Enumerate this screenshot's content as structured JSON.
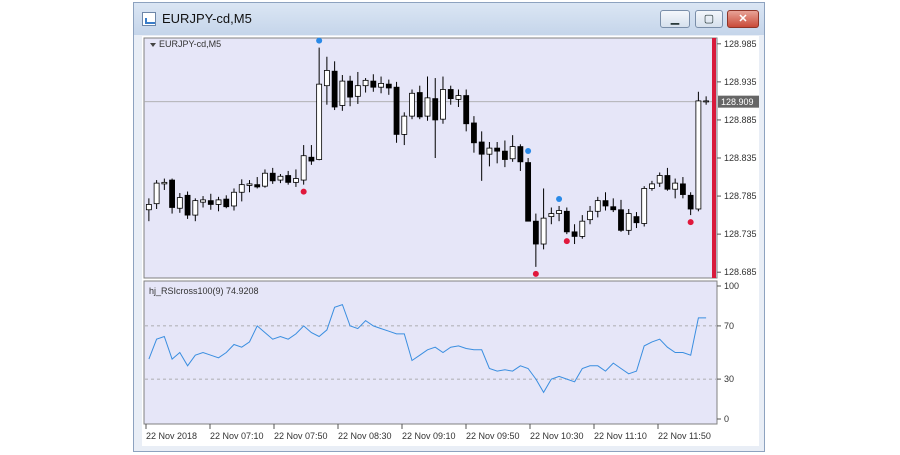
{
  "window": {
    "title": "EURJPY-cd,M5",
    "buttons": {
      "minimize": "minimize",
      "maximize": "maximize",
      "close": "close"
    }
  },
  "chart_data": [
    {
      "type": "candlestick",
      "title": "EURJPY-cd,M5",
      "current_price": "128.909",
      "ylim": [
        128.68,
        128.99
      ],
      "y_ticks": [
        "128.985",
        "128.935",
        "128.885",
        "128.835",
        "128.785",
        "128.735",
        "128.685"
      ],
      "x_ticks": [
        "22 Nov 2018",
        "22 Nov 07:10",
        "22 Nov 07:50",
        "22 Nov 08:30",
        "22 Nov 09:10",
        "22 Nov 09:50",
        "22 Nov 10:30",
        "22 Nov 11:10",
        "22 Nov 11:50"
      ],
      "candles": [
        [
          128.767,
          128.782,
          128.752,
          128.774
        ],
        [
          128.775,
          128.806,
          128.768,
          128.802
        ],
        [
          128.801,
          128.808,
          128.793,
          128.803
        ],
        [
          128.806,
          128.808,
          128.762,
          128.77
        ],
        [
          128.769,
          128.789,
          128.763,
          128.783
        ],
        [
          128.786,
          128.791,
          128.755,
          128.76
        ],
        [
          128.76,
          128.782,
          128.752,
          128.779
        ],
        [
          128.777,
          128.785,
          128.77,
          128.78
        ],
        [
          128.779,
          128.788,
          128.767,
          128.774
        ],
        [
          128.774,
          128.784,
          128.765,
          128.78
        ],
        [
          128.781,
          128.786,
          128.769,
          128.771
        ],
        [
          128.772,
          128.795,
          128.766,
          128.79
        ],
        [
          128.79,
          128.807,
          128.778,
          128.8
        ],
        [
          128.799,
          128.806,
          128.79,
          128.801
        ],
        [
          128.8,
          128.81,
          128.795,
          128.797
        ],
        [
          128.798,
          128.82,
          128.796,
          128.815
        ],
        [
          128.815,
          128.822,
          128.801,
          128.805
        ],
        [
          128.806,
          128.814,
          128.802,
          128.811
        ],
        [
          128.812,
          128.818,
          128.8,
          128.803
        ],
        [
          128.803,
          128.82,
          128.797,
          128.808
        ],
        [
          128.806,
          128.852,
          128.8,
          128.838
        ],
        [
          128.836,
          128.852,
          128.826,
          128.831
        ],
        [
          128.833,
          128.98,
          128.832,
          128.932
        ],
        [
          128.93,
          128.968,
          128.905,
          128.95
        ],
        [
          128.949,
          128.962,
          128.898,
          128.902
        ],
        [
          128.904,
          128.944,
          128.897,
          128.936
        ],
        [
          128.936,
          128.943,
          128.903,
          128.915
        ],
        [
          128.916,
          128.948,
          128.906,
          128.93
        ],
        [
          128.93,
          128.94,
          128.921,
          128.937
        ],
        [
          128.936,
          128.945,
          128.922,
          128.928
        ],
        [
          128.928,
          128.942,
          128.92,
          128.933
        ],
        [
          128.932,
          128.938,
          128.918,
          128.927
        ],
        [
          128.928,
          128.935,
          128.855,
          128.866
        ],
        [
          128.866,
          128.895,
          128.852,
          128.89
        ],
        [
          128.89,
          128.925,
          128.886,
          128.92
        ],
        [
          128.921,
          128.93,
          128.886,
          128.889
        ],
        [
          128.89,
          128.942,
          128.884,
          128.914
        ],
        [
          128.913,
          128.94,
          128.835,
          128.885
        ],
        [
          128.886,
          128.942,
          128.88,
          128.925
        ],
        [
          128.925,
          128.93,
          128.905,
          128.913
        ],
        [
          128.912,
          128.925,
          128.902,
          128.917
        ],
        [
          128.917,
          128.925,
          128.87,
          128.88
        ],
        [
          128.881,
          128.89,
          128.842,
          128.855
        ],
        [
          128.856,
          128.87,
          128.805,
          128.84
        ],
        [
          128.84,
          128.856,
          128.824,
          128.848
        ],
        [
          128.848,
          128.856,
          128.828,
          128.844
        ],
        [
          128.844,
          128.858,
          128.823,
          128.833
        ],
        [
          128.834,
          128.865,
          128.83,
          128.85
        ],
        [
          128.85,
          128.853,
          128.818,
          128.83
        ],
        [
          128.829,
          128.835,
          128.755,
          128.752
        ],
        [
          128.752,
          128.762,
          128.692,
          128.722
        ],
        [
          128.722,
          128.795,
          128.715,
          128.756
        ],
        [
          128.758,
          128.77,
          128.748,
          128.762
        ],
        [
          128.762,
          128.772,
          128.752,
          128.766
        ],
        [
          128.765,
          128.77,
          128.735,
          128.738
        ],
        [
          128.738,
          128.748,
          128.722,
          128.732
        ],
        [
          128.732,
          128.76,
          128.729,
          128.752
        ],
        [
          128.754,
          128.772,
          128.748,
          128.765
        ],
        [
          128.765,
          128.784,
          128.757,
          128.779
        ],
        [
          128.779,
          128.79,
          128.766,
          128.772
        ],
        [
          128.771,
          128.782,
          128.764,
          128.767
        ],
        [
          128.767,
          128.78,
          128.738,
          128.74
        ],
        [
          128.74,
          128.768,
          128.734,
          128.762
        ],
        [
          128.758,
          128.764,
          128.743,
          128.75
        ],
        [
          128.749,
          128.798,
          128.745,
          128.795
        ],
        [
          128.795,
          128.805,
          128.792,
          128.801
        ],
        [
          128.802,
          128.816,
          128.797,
          128.812
        ],
        [
          128.812,
          128.822,
          128.792,
          128.794
        ],
        [
          128.794,
          128.808,
          128.782,
          128.802
        ],
        [
          128.801,
          128.81,
          128.782,
          128.787
        ],
        [
          128.786,
          128.79,
          128.76,
          128.768
        ],
        [
          128.768,
          128.922,
          128.765,
          128.91
        ],
        [
          128.91,
          128.916,
          128.905,
          128.91
        ]
      ],
      "buy_arrows_candle_index": [
        22,
        49,
        53
      ],
      "sell_arrows_candle_index": [
        20,
        50,
        54,
        70
      ],
      "indicator": {
        "label": "hj_RSIcross100(9) 74.9208",
        "ylim": [
          0,
          100
        ],
        "y_ticks": [
          "100",
          "70",
          "30",
          "0"
        ],
        "levels": [
          70,
          30
        ],
        "values": [
          45,
          60,
          62,
          45,
          50,
          40,
          48,
          50,
          48,
          46,
          50,
          56,
          54,
          58,
          70,
          65,
          60,
          62,
          60,
          64,
          70,
          65,
          62,
          67,
          84,
          86,
          70,
          68,
          74,
          70,
          68,
          66,
          64,
          64,
          44,
          48,
          52,
          54,
          50,
          54,
          55,
          53,
          52,
          52,
          38,
          36,
          37,
          36,
          40,
          38,
          30,
          20,
          30,
          32,
          30,
          28,
          38,
          40,
          40,
          36,
          42,
          38,
          34,
          36,
          55,
          58,
          60,
          54,
          50,
          50,
          48,
          76,
          76
        ]
      }
    }
  ],
  "colors": {
    "plot_bg": "#e6e6f8",
    "bull_fill": "#ffffff",
    "bear_fill": "#000000",
    "buy_dot": "#2a8ae8",
    "sell_dot": "#e0183c",
    "rsi_line": "#3a8ee0",
    "price_line": "#aaaaaa",
    "right_bar": "#d81b3c"
  }
}
